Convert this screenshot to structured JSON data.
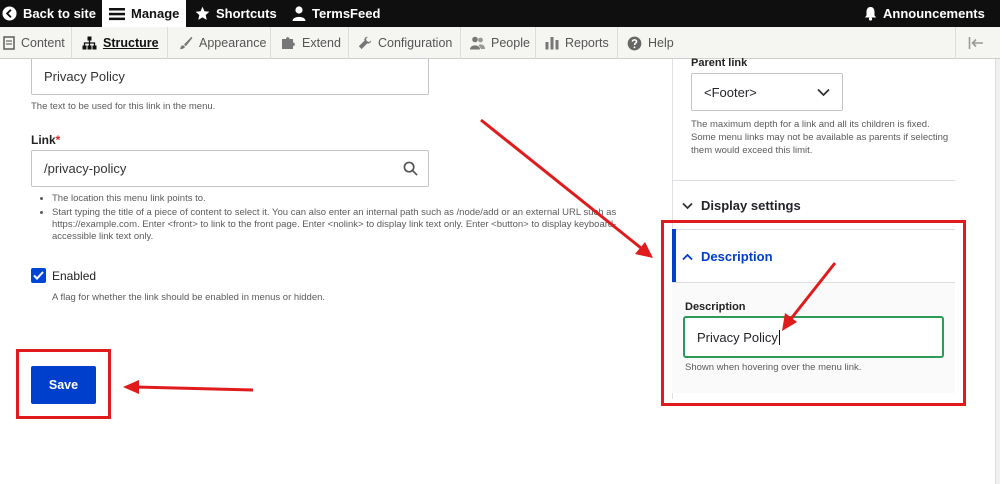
{
  "toolbar": {
    "back_to_site": "Back to site",
    "manage": "Manage",
    "shortcuts": "Shortcuts",
    "user": "TermsFeed",
    "announcements": "Announcements"
  },
  "admin_menu": {
    "content": "Content",
    "structure": "Structure",
    "appearance": "Appearance",
    "extend": "Extend",
    "configuration": "Configuration",
    "people": "People",
    "reports": "Reports",
    "help": "Help"
  },
  "form": {
    "title_value": "Privacy Policy",
    "title_help": "The text to be used for this link in the menu.",
    "link_label": "Link",
    "link_required": "*",
    "link_value": "/privacy-policy",
    "link_help_1": "The location this menu link points to.",
    "link_help_2": "Start typing the title of a piece of content to select it. You can also enter an internal path such as /node/add or an external URL such as https://example.com. Enter <front> to link to the front page. Enter <nolink> to display link text only. Enter <button> to display keyboard-accessible link text only.",
    "enabled_label": "Enabled",
    "enabled_checked": true,
    "enabled_help": "A flag for whether the link should be enabled in menus or hidden.",
    "save_label": "Save"
  },
  "sidebar": {
    "parent_link_label": "Parent link",
    "parent_link_value": "<Footer>",
    "parent_help": "The maximum depth for a link and all its children is fixed. Some menu links may not be available as parents if selecting them would exceed this limit.",
    "display_settings": "Display settings",
    "description_section": "Description",
    "description_label": "Description",
    "description_value": "Privacy Policy",
    "description_help": "Shown when hovering over the menu link."
  },
  "colors": {
    "accent_blue": "#003ecc",
    "annotation_red": "#e01b1b",
    "focus_green": "#2c9b57",
    "toolbar_black": "#0f0f0f"
  }
}
